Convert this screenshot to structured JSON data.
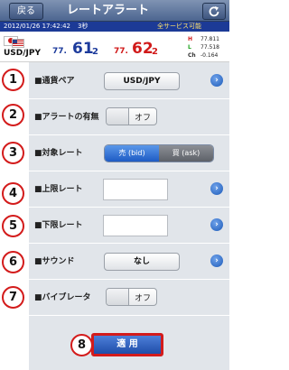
{
  "header": {
    "back_label": "戻る",
    "title": "レートアラート",
    "refresh_icon": "refresh-icon"
  },
  "status": {
    "date": "2012/01/26 17:42:42",
    "seconds": "3秒",
    "service": "全サービス可能"
  },
  "rate": {
    "pair": "USD/JPY",
    "bid": {
      "prefix": "77.",
      "big": "61",
      "tail": "2"
    },
    "ask": {
      "prefix": "77.",
      "big": "62",
      "tail": "2"
    },
    "high": "77.811",
    "low": "77.518",
    "change": "-0.164"
  },
  "settings": {
    "pair": {
      "number": "1",
      "label": "■通貨ペア",
      "value": "USD/JPY"
    },
    "alert": {
      "number": "2",
      "label": "■アラートの有無",
      "toggle": "オフ"
    },
    "target": {
      "number": "3",
      "label": "■対象レート",
      "bid": "売 (bid)",
      "ask": "買 (ask)"
    },
    "upper": {
      "number": "4",
      "label": "■上限レート",
      "value": ""
    },
    "lower": {
      "number": "5",
      "label": "■下限レート",
      "value": ""
    },
    "sound": {
      "number": "6",
      "label": "■サウンド",
      "value": "なし"
    },
    "vibrator": {
      "number": "7",
      "label": "■バイブレータ",
      "toggle": "オフ"
    },
    "apply": {
      "number": "8",
      "label": "適 用"
    }
  },
  "colors": {
    "accent": "#1e5bc4",
    "highlight": "#d31b1b",
    "header": "#4c6590"
  }
}
